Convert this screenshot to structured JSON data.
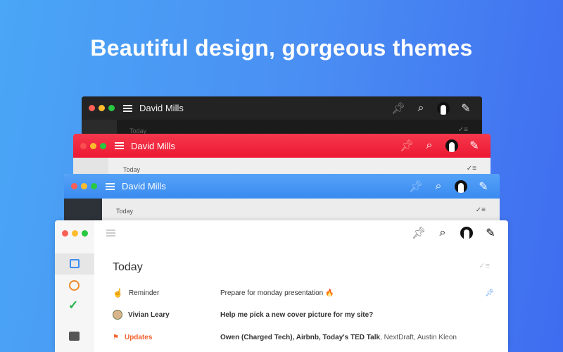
{
  "headline": "Beautiful design, gorgeous themes",
  "windows": [
    {
      "theme": "dark",
      "title": "David Mills",
      "today": "Today"
    },
    {
      "theme": "red",
      "title": "David Mills",
      "today": "Today"
    },
    {
      "theme": "blue",
      "title": "David Mills",
      "today": "Today"
    }
  ],
  "front": {
    "section_title": "Today",
    "rows": [
      {
        "label": "Reminder",
        "text": "Prepare for monday presentation 🔥",
        "pinned": true
      },
      {
        "label": "Vivian Leary",
        "text": "Help me pick a new cover picture for my site?"
      },
      {
        "label": "Updates",
        "senders_bold": "Owen (Charged Tech), Airbnb, Today's TED Talk",
        "senders_rest": ", NextDraft, Austin Kleon"
      }
    ]
  },
  "colors": {
    "dark": "#232323",
    "red": "#f2283f",
    "blue": "#3d90f3",
    "accent_orange": "#f4622e",
    "check_green": "#21b04b"
  }
}
